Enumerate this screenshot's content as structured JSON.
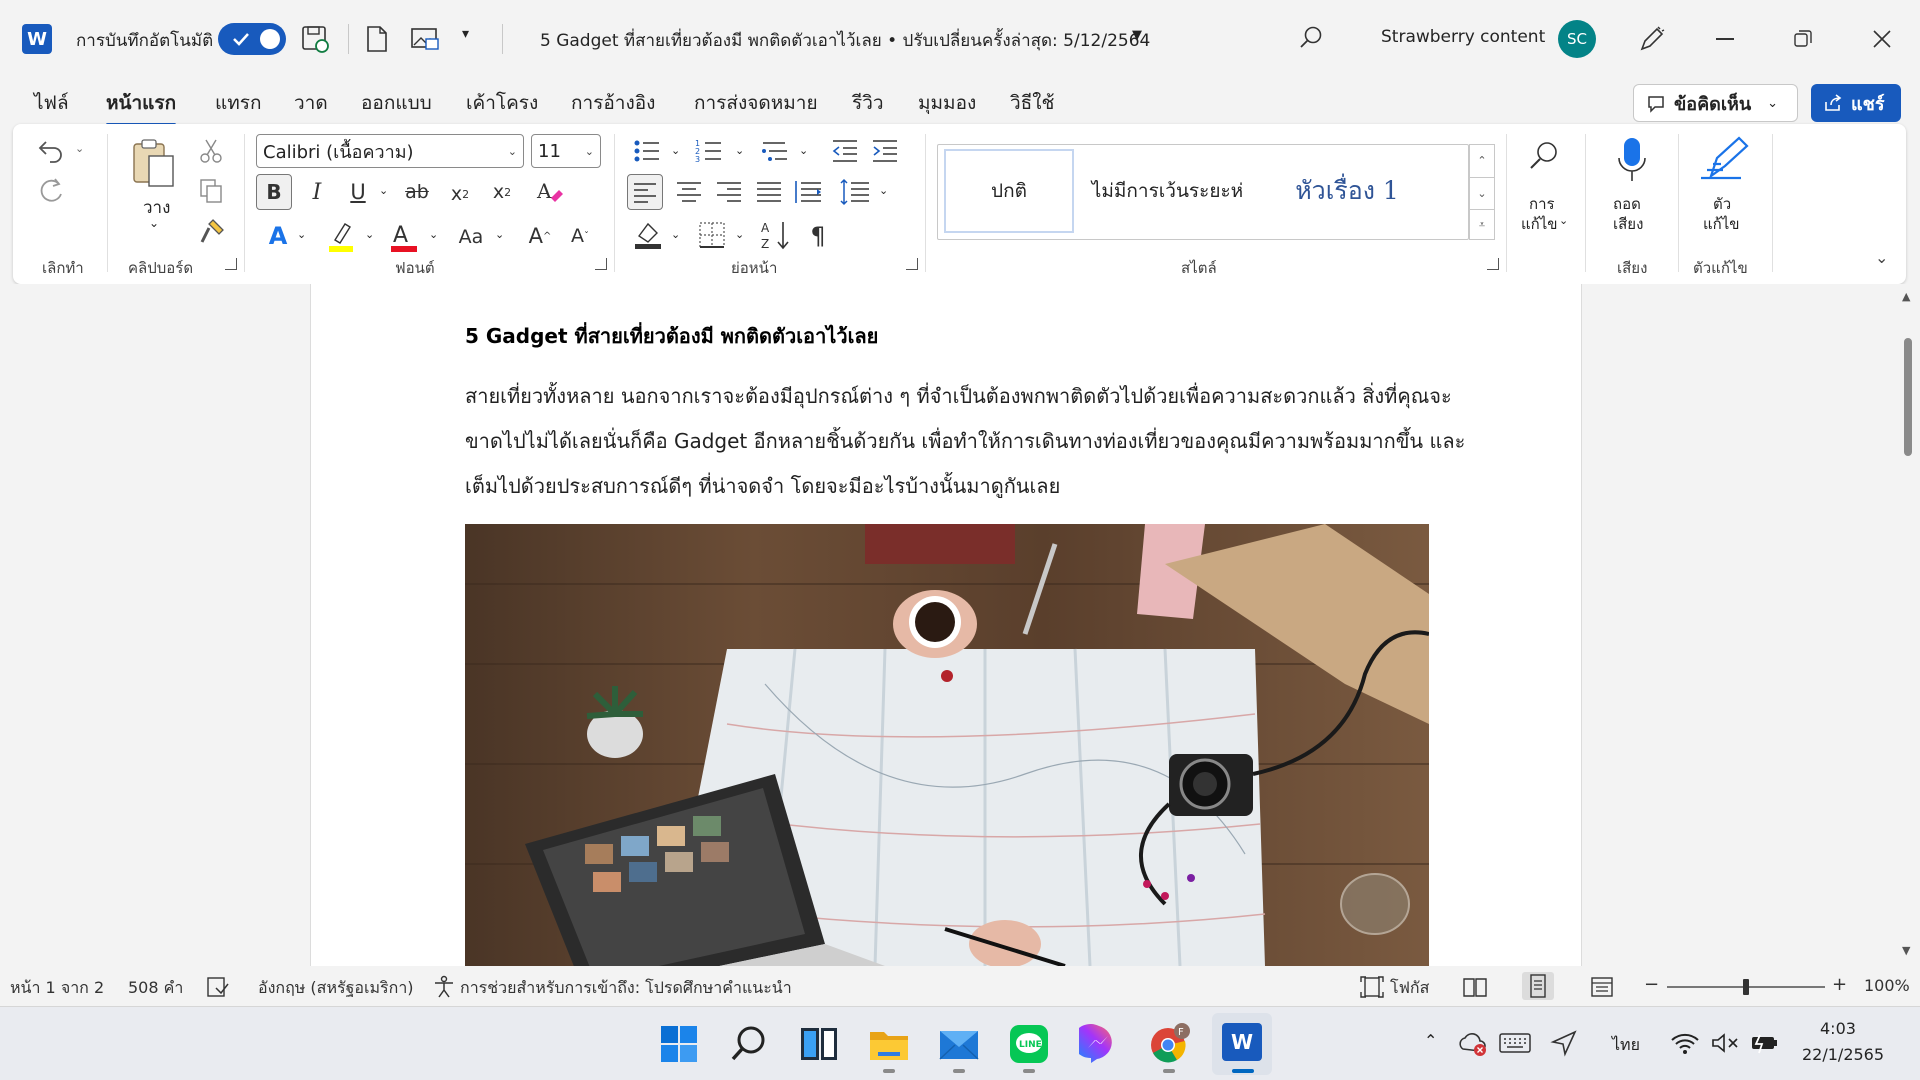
{
  "titlebar": {
    "autosave_label": "การบันทึกอัตโนมัติ",
    "doc_title": "5 Gadget ที่สายเที่ยวต้องมี พกติดตัวเอาไว้เลย • ปรับเปลี่ยนครั้งล่าสุด: 5/12/2564",
    "user_name": "Strawberry content",
    "user_initials": "SC"
  },
  "tabs": [
    "ไฟล์",
    "หน้าแรก",
    "แทรก",
    "วาด",
    "ออกแบบ",
    "เค้าโครง",
    "การอ้างอิง",
    "การส่งจดหมาย",
    "รีวิว",
    "มุมมอง",
    "วิธีใช้"
  ],
  "actions": {
    "comments_label": "ข้อคิดเห็น",
    "share_label": "แชร์"
  },
  "ribbon": {
    "undo_label": "เลิกทำ",
    "paste_label": "วาง",
    "clipboard_label": "คลิปบอร์ด",
    "font_name": "Calibri (เนื้อความ)",
    "font_size": "11",
    "font_label": "ฟอนต์",
    "paragraph_label": "ย่อหน้า",
    "styles": [
      "ปกติ",
      "ไม่มีการเว้นระยะห่",
      "หัวเรื่อง 1"
    ],
    "styles_label": "สไตล์",
    "find_label_1": "การ",
    "find_label_2": "แก้ไข",
    "dictate_label_1": "ถอด",
    "dictate_label_2": "เสียง",
    "voice_label": "เสียง",
    "editor_label_1": "ตัว",
    "editor_label_2": "แก้ไข",
    "editor_group_label": "ตัวแก้ไข"
  },
  "document": {
    "heading": "5 Gadget ที่สายเที่ยวต้องมี พกติดตัวเอาไว้เลย",
    "lines": [
      "สายเที่ยวทั้งหลาย นอกจากเราจะต้องมีอุปกรณ์ต่าง ๆ ที่จำเป็นต้องพกพาติดตัวไปด้วยเพื่อความสะดวกแล้ว สิ่งที่คุณจะ",
      "ขาดไปไม่ได้เลยนั่นก็คือ Gadget อีกหลายชิ้นด้วยกัน เพื่อทำให้การเดินทางท่องเที่ยวของคุณมีความพร้อมมากขึ้น และ",
      "เต็มไปด้วยประสบการณ์ดีๆ ที่น่าจดจำ โดยจะมีอะไรบ้างนั้นมาดูกันเลย"
    ]
  },
  "statusbar": {
    "page": "หน้า 1 จาก 2",
    "words": "508 คำ",
    "language": "อังกฤษ (สหรัฐอเมริกา)",
    "accessibility": "การช่วยสำหรับการเข้าถึง: โปรดศึกษาคำแนะนำ",
    "focus": "โฟกัส",
    "zoom": "100%",
    "zoom_level": 1.0
  },
  "taskbar": {
    "language": "ไทย",
    "time": "4:03",
    "date": "22/1/2565",
    "chrome_badge": "F"
  },
  "colors": {
    "accent": "#185abd",
    "avatar": "#038387"
  }
}
